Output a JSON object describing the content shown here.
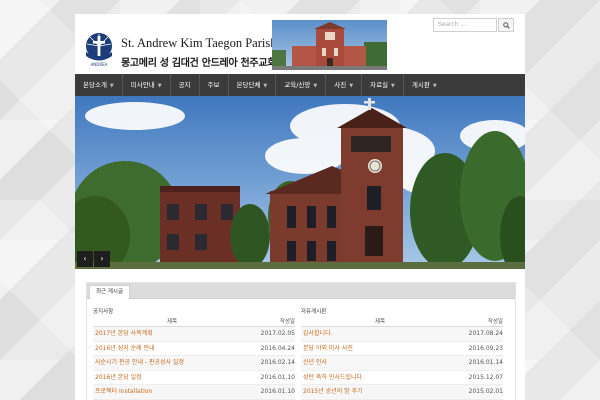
{
  "header": {
    "title_en": "St. Andrew Kim Taegon Parish",
    "title_ko": "몽고메리 성 김대건 안드레아 천주교회",
    "emblem_caption": "ANDREA"
  },
  "search": {
    "placeholder": "Search ..."
  },
  "nav": {
    "items": [
      {
        "label": "본당소개",
        "dropdown": true
      },
      {
        "label": "미사안내",
        "dropdown": true
      },
      {
        "label": "공지",
        "dropdown": false
      },
      {
        "label": "주보",
        "dropdown": false
      },
      {
        "label": "본당단체",
        "dropdown": true
      },
      {
        "label": "교육/신앙",
        "dropdown": true
      },
      {
        "label": "사진",
        "dropdown": true
      },
      {
        "label": "자료실",
        "dropdown": true
      },
      {
        "label": "게시판",
        "dropdown": true
      }
    ]
  },
  "slider": {
    "prev": "‹",
    "next": "›",
    "slide_count": 2,
    "active_slide": 2
  },
  "panel": {
    "tab_label": "최근 게시글",
    "left": {
      "title": "공지사항",
      "col_title": "제목",
      "col_date": "작성일",
      "rows": [
        {
          "title": "2017년 본당 사목계획",
          "date": "2017.02.05"
        },
        {
          "title": "2016년 성지 순례 안내",
          "date": "2016.04.24"
        },
        {
          "title": "사순시기 판공 안내 - 판공성사 일정",
          "date": "2016.02.14"
        },
        {
          "title": "2016년 본당 일정",
          "date": "2016.01.10"
        },
        {
          "title": "프로젝터 Installation",
          "date": "2016.01.10"
        }
      ]
    },
    "right": {
      "title": "자유게시판",
      "col_title": "제목",
      "col_date": "작성일",
      "rows": [
        {
          "title": "감사합니다.",
          "date": "2017.08.24"
        },
        {
          "title": "본당 야외 미사 사진",
          "date": "2016.09.23"
        },
        {
          "title": "신년 인사",
          "date": "2016.01.14"
        },
        {
          "title": "성탄 축하 인사드립니다.",
          "date": "2015.12.07"
        },
        {
          "title": "2015년 송년의 밤 후기",
          "date": "2015.02.01"
        }
      ]
    }
  },
  "colors": {
    "nav_bg": "#3b3b3b",
    "link": "#c66a1e",
    "brick": "#7a3a2c",
    "emblem": "#1c3d7a"
  }
}
